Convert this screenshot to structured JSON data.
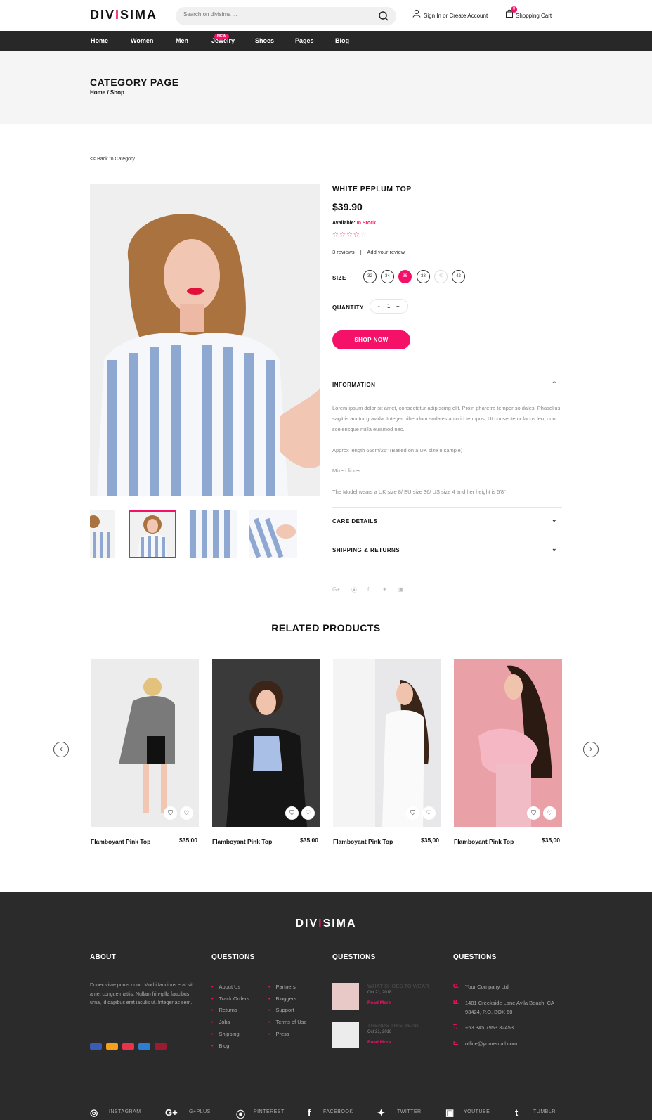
{
  "header": {
    "logo_main": "DIVISIMA",
    "search_placeholder": "Search on divisima ...",
    "signin": "Sign In or Create Account",
    "cart": "Shopping Cart",
    "cart_count": "0"
  },
  "nav": {
    "items": [
      "Home",
      "Women",
      "Men",
      "Jewelry",
      "Shoes",
      "Pages",
      "Blog"
    ],
    "new_badge": "NEW"
  },
  "hero": {
    "title": "CATEGORY PAGE",
    "breadcrumb": "Home / Shop"
  },
  "back_link": "<< Back to Category",
  "product": {
    "title": "WHITE PEPLUM TOP",
    "price": "$39.90",
    "available_label": "Available:",
    "available_value": "In Stock",
    "rating": 4,
    "reviews": "3 reviews",
    "review_sep": "|",
    "add_review": "Add your review",
    "size_label": "SIZE",
    "sizes": [
      "32",
      "34",
      "36",
      "38",
      "40",
      "42"
    ],
    "selected_size": "36",
    "disabled_size": "40",
    "quantity_label": "QUANTITY",
    "qty_minus": "-",
    "qty_value": "1",
    "qty_plus": "+",
    "shop_button": "SHOP NOW"
  },
  "accordion": {
    "information_title": "INFORMATION",
    "information_p1": "Lorem ipsum dolor sit amet, consectetur adipiscing elit. Proin pharetra tempor so dales. Phasellus sagittis auctor gravida. Integer bibendum sodales arcu id te mpus. Ut consectetur lacus leo, non scelerisque nulla euismod nec.",
    "information_p2": "Approx length 66cm/26\" (Based on a UK size 8 sample)",
    "information_p3": "Mixed fibres",
    "information_p4": "The Model wears a UK size 8/ EU size 36/ US size 4 and her height is 5'8\"",
    "care_title": "CARE DETAILS",
    "shipping_title": "SHIPPING & RETURNS"
  },
  "related": {
    "title": "RELATED PRODUCTS",
    "products": [
      {
        "name": "Flamboyant Pink Top",
        "price": "$35,00"
      },
      {
        "name": "Flamboyant Pink Top",
        "price": "$35,00"
      },
      {
        "name": "Flamboyant Pink Top",
        "price": "$35,00"
      },
      {
        "name": "Flamboyant Pink Top",
        "price": "$35,00"
      }
    ]
  },
  "footer": {
    "logo": "DIVISIMA",
    "about_title": "ABOUT",
    "about_text": "Donec vitae purus nunc. Morbi faucibus erat sit amet congue mattis. Nullam frin-gilla faucibus urna, id dapibus erat iaculis ut. Integer ac sem.",
    "col2_title": "QUESTIONS",
    "links_a": [
      "About Us",
      "Track Orders",
      "Returns",
      "Jobs",
      "Shipping",
      "Blog"
    ],
    "links_b": [
      "Partners",
      "Bloggers",
      "Support",
      "Terms of Use",
      "Press"
    ],
    "col3_title": "QUESTIONS",
    "posts": [
      {
        "title": "WHAT SHOES TO WEAR",
        "date": "Oct 21, 2018",
        "read": "Read More"
      },
      {
        "title": "TRENDS THIS YEAR",
        "date": "Oct 21, 2018",
        "read": "Read More"
      }
    ],
    "col4_title": "QUESTIONS",
    "contact": [
      {
        "k": "C.",
        "v": "Your Company Ltd"
      },
      {
        "k": "B.",
        "v": "1481 Creekside Lane Avila Beach, CA 93424, P.O. BOX 68"
      },
      {
        "k": "T.",
        "v": "+53 345 7953 32453"
      },
      {
        "k": "E.",
        "v": "office@youremail.com"
      }
    ],
    "social": [
      "INSTAGRAM",
      "G+PLUS",
      "PINTEREST",
      "FACEBOOK",
      "TWITTER",
      "YOUTUBE",
      "TUMBLR"
    ]
  },
  "colors": {
    "accent": "#f51167",
    "dark": "#282828",
    "footer": "#2b2b2b"
  }
}
